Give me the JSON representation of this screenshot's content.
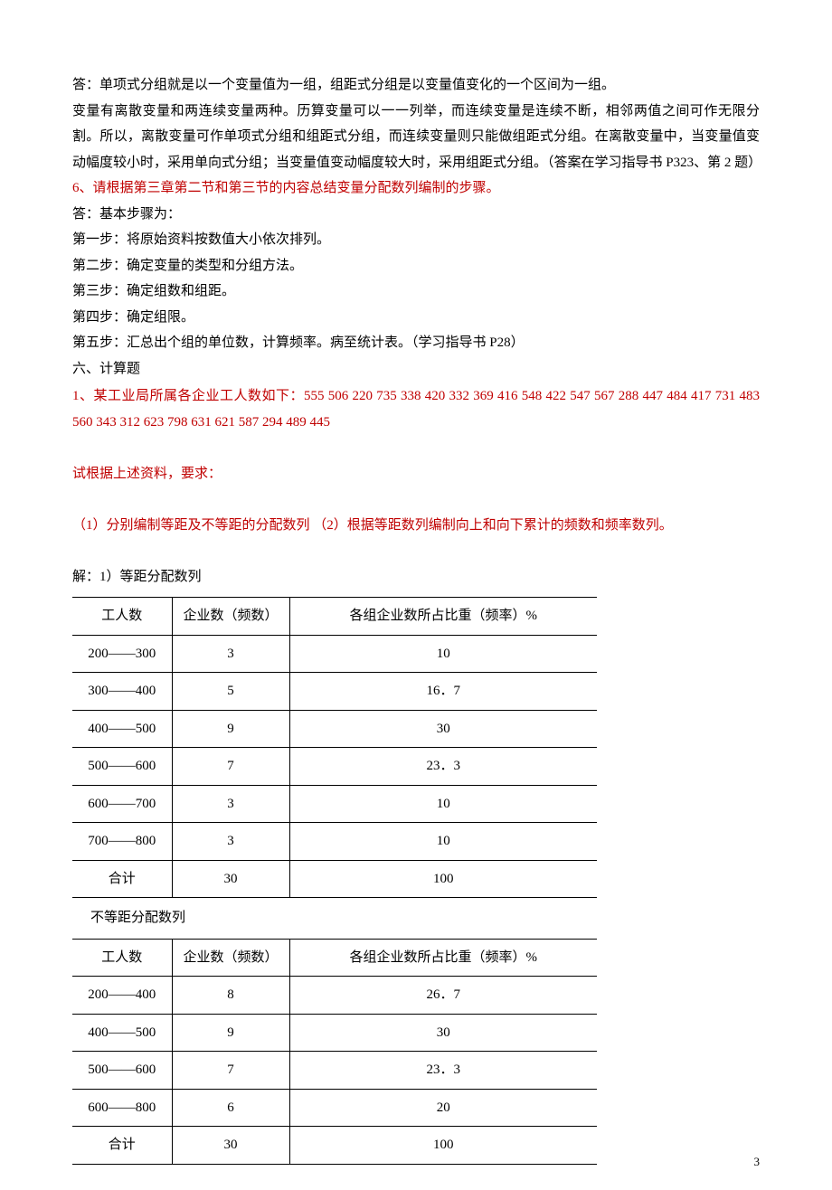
{
  "paras": {
    "p1": "答：单项式分组就是以一个变量值为一组，组距式分组是以变量值变化的一个区间为一组。",
    "p2": "变量有离散变量和两连续变量两种。历算变量可以一一列举，而连续变量是连续不断，相邻两值之间可作无限分割。所以，离散变量可作单项式分组和组距式分组，而连续变量则只能做组距式分组。在离散变量中，当变量值变动幅度较小时，采用单向式分组；当变量值变动幅度较大时，采用组距式分组。（答案在学习指导书 P323、第 2 题）",
    "q6": "6、请根据第三章第二节和第三节的内容总结变量分配数列编制的步骤。",
    "a6_intro": "答：基本步骤为：",
    "s1": "第一步：将原始资料按数值大小依次排列。",
    "s2": "第二步：确定变量的类型和分组方法。",
    "s3": "第三步：确定组数和组距。",
    "s4": "第四步：确定组限。",
    "s5": "第五步：汇总出个组的单位数，计算频率。病至统计表。（学习指导书 P28）",
    "section6": "六、计算题",
    "calc1a": "1、某工业局所属各企业工人数如下：555   506   220   735   338   420   332   369   416   548  422   547  567   288   447   484   417   731   483   560   343   312  623   798   631   621   587   294   489   445",
    "calc1b": "试根据上述资料，要求：",
    "calc1c": "（1）分别编制等距及不等距的分配数列  （2）根据等距数列编制向上和向下累计的频数和频率数列。",
    "sol1": "解：1）等距分配数列",
    "sol2": "不等距分配数列"
  },
  "table1": {
    "headers": {
      "h1": "工人数",
      "h2": "企业数（频数）",
      "h3": "各组企业数所占比重（频率）%"
    },
    "rows": [
      {
        "range": "200——300",
        "count": "3",
        "ratio": "10"
      },
      {
        "range": "300——400",
        "count": "5",
        "ratio": "16．7"
      },
      {
        "range": "400——500",
        "count": "9",
        "ratio": "30"
      },
      {
        "range": "500——600",
        "count": "7",
        "ratio": "23．3"
      },
      {
        "range": "600——700",
        "count": "3",
        "ratio": "10"
      },
      {
        "range": "700——800",
        "count": "3",
        "ratio": "10"
      }
    ],
    "total": {
      "label": "合计",
      "count": "30",
      "ratio": "100"
    }
  },
  "table2": {
    "headers": {
      "h1": "工人数",
      "h2": "企业数（频数）",
      "h3": "各组企业数所占比重（频率）%"
    },
    "rows": [
      {
        "range": "200——400",
        "count": "8",
        "ratio": "26．7"
      },
      {
        "range": "400——500",
        "count": "9",
        "ratio": "30"
      },
      {
        "range": "500——600",
        "count": "7",
        "ratio": "23．3"
      },
      {
        "range": "600——800",
        "count": "6",
        "ratio": "20"
      }
    ],
    "total": {
      "label": "合计",
      "count": "30",
      "ratio": "100"
    }
  },
  "page_number": "3"
}
